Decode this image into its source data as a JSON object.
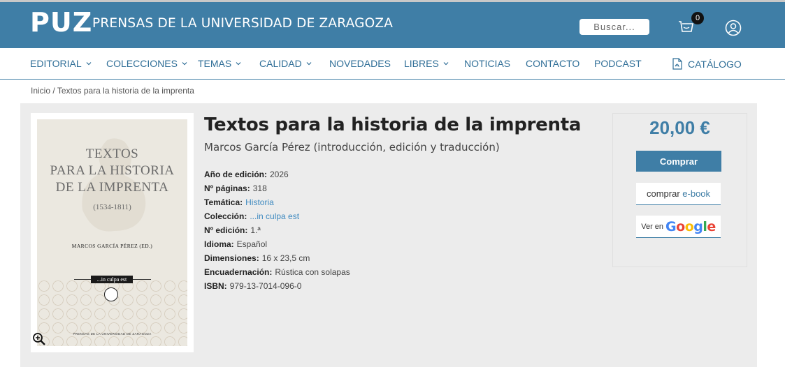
{
  "header": {
    "logo": "PUZ",
    "logo_text": "PRENSAS DE LA UNIVERSIDAD DE ZARAGOZA",
    "search_placeholder": "Buscar...",
    "cart_count": "0",
    "icons": {
      "cart": "cart-icon",
      "user": "user-icon"
    }
  },
  "nav": {
    "items": [
      {
        "label": "EDITORIAL",
        "has_dropdown": true
      },
      {
        "label": "COLECCIONES",
        "has_dropdown": true
      },
      {
        "label": "TEMAS",
        "has_dropdown": true
      },
      {
        "label": "CALIDAD",
        "has_dropdown": true
      },
      {
        "label": "NOVEDADES",
        "has_dropdown": false
      },
      {
        "label": "LIBRES",
        "has_dropdown": true
      },
      {
        "label": "NOTICIAS",
        "has_dropdown": false
      },
      {
        "label": "CONTACTO",
        "has_dropdown": false
      },
      {
        "label": "PODCAST",
        "has_dropdown": false
      }
    ],
    "catalog_label": "CATÁLOGO"
  },
  "breadcrumb": {
    "home": "Inicio",
    "separator": " / ",
    "current": "Textos para la historia de la imprenta"
  },
  "cover": {
    "title_lines": [
      "TEXTOS",
      "PARA LA HISTORIA",
      "DE LA IMPRENTA"
    ],
    "years": "(1534-1811)",
    "author": "MARCOS GARCÍA PÉREZ (ED.)",
    "series": "...in culpa est",
    "publisher": "PRENSAS DE LA UNIVERSIDAD DE ZARAGOZA"
  },
  "book": {
    "title": "Textos para la historia de la imprenta",
    "author": "Marcos García Pérez (introducción, edición y traducción)",
    "specs": [
      {
        "label": "Año de edición:",
        "value": "2026"
      },
      {
        "label": "Nº páginas:",
        "value": "318"
      },
      {
        "label": "Temática:",
        "value": "Historia"
      },
      {
        "label": "Colección:",
        "value": "...in culpa est"
      },
      {
        "label": "Nº edición:",
        "value": "1.ª"
      },
      {
        "label": "Idioma:",
        "value": "Español"
      },
      {
        "label": "Dimensiones:",
        "value": "16 x 23,5 cm"
      },
      {
        "label": "Encuadernación:",
        "value": "Rústica con solapas"
      },
      {
        "label": "ISBN:",
        "value": "979-13-7014-096-0"
      }
    ]
  },
  "buy": {
    "price": "20,00 €",
    "buy_label": "Comprar",
    "ebook_prefix": "comprar",
    "ebook_highlight": "e-book",
    "google_prefix": "Ver en",
    "google_letters": [
      "G",
      "o",
      "o",
      "g",
      "l",
      "e"
    ],
    "google_colors": [
      "#4285F4",
      "#EA4335",
      "#FBBC05",
      "#4285F4",
      "#34A853",
      "#EA4335"
    ]
  },
  "colors": {
    "brand": "#3f7ea6",
    "link": "#3f8ac0"
  }
}
